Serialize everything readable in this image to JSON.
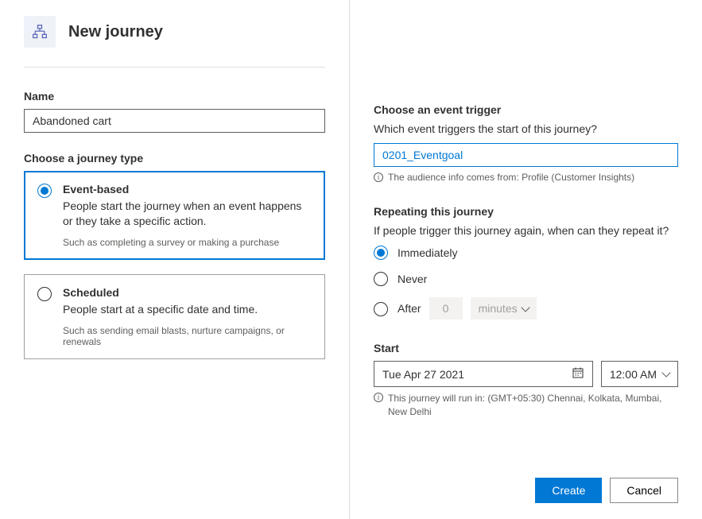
{
  "header": {
    "title": "New journey"
  },
  "left": {
    "name_label": "Name",
    "name_value": "Abandoned cart",
    "type_label": "Choose a journey type",
    "option_event": {
      "title": "Event-based",
      "desc": "People start the journey when an event happens or they take a specific action.",
      "example": "Such as completing a survey or making a purchase"
    },
    "option_scheduled": {
      "title": "Scheduled",
      "desc": "People start at a specific date and time.",
      "example": "Such as sending email blasts, nurture campaigns, or renewals"
    }
  },
  "right": {
    "trigger_label": "Choose an event trigger",
    "trigger_sub": "Which event triggers the start of this journey?",
    "trigger_value": "0201_Eventgoal",
    "trigger_info": "The audience info comes from: Profile (Customer Insights)",
    "repeat_label": "Repeating this journey",
    "repeat_sub": "If people trigger this journey again, when can they repeat it?",
    "repeat_immediately": "Immediately",
    "repeat_never": "Never",
    "repeat_after": "After",
    "repeat_after_value": "0",
    "repeat_after_unit": "minutes",
    "start_label": "Start",
    "start_date": "Tue Apr 27 2021",
    "start_time": "12:00 AM",
    "tz_info": "This journey will run in: (GMT+05:30) Chennai, Kolkata, Mumbai, New Delhi"
  },
  "footer": {
    "create": "Create",
    "cancel": "Cancel"
  }
}
